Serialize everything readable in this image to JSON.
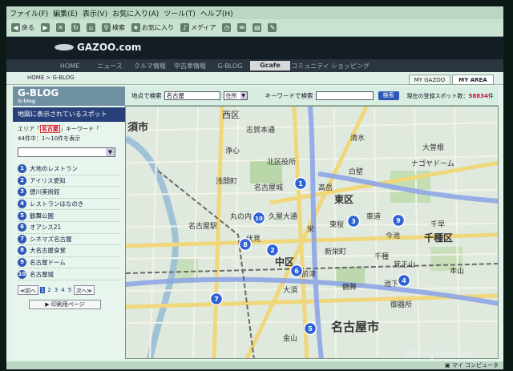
{
  "menubar": {
    "items": [
      "ファイル(F)",
      "編集(E)",
      "表示(V)",
      "お気に入り(A)",
      "ツール(T)",
      "ヘルプ(H)"
    ]
  },
  "toolbar": {
    "items": [
      {
        "label": "戻る",
        "icon": "back-icon"
      },
      {
        "label": "",
        "icon": "forward-icon"
      },
      {
        "label": "",
        "icon": "stop-icon"
      },
      {
        "label": "",
        "icon": "refresh-icon"
      },
      {
        "label": "",
        "icon": "home-icon"
      },
      {
        "label": "検索",
        "icon": "search-icon"
      },
      {
        "label": "お気に入り",
        "icon": "star-icon"
      },
      {
        "label": "メディア",
        "icon": "media-icon"
      },
      {
        "label": "",
        "icon": "history-icon"
      },
      {
        "label": "",
        "icon": "mail-icon"
      },
      {
        "label": "",
        "icon": "print-icon"
      },
      {
        "label": "",
        "icon": "edit-icon"
      }
    ]
  },
  "site": {
    "logo": "GAZOO.com",
    "nav": [
      "HOME",
      "ニュース",
      "クルマ情報",
      "中古車情報",
      "G-BLOG",
      "Gcafe",
      "コミュニティ",
      "ショッピング"
    ],
    "nav_active_index": 5,
    "breadcrumb": "HOME > G-BLOG",
    "tabs": {
      "my_gazoo": "MY GAZOO",
      "my_area": "MY AREA"
    }
  },
  "sidebar": {
    "title": "G-BLOG",
    "subtitle": "G-blog",
    "spots_header": "地図に表示されているスポット",
    "area_prefix": "エリア「",
    "area_value": "名古屋",
    "area_suffix": "」キーワード「",
    "keyword_value": "",
    "count_text": "44件中：1〜10件を表示",
    "select_value": "",
    "spots": [
      {
        "num": "1",
        "name": "大地のレストラン"
      },
      {
        "num": "2",
        "name": "アイリス愛知"
      },
      {
        "num": "3",
        "name": "徳川美術館"
      },
      {
        "num": "4",
        "name": "レストランはなのき"
      },
      {
        "num": "5",
        "name": "鶴舞公園"
      },
      {
        "num": "6",
        "name": "オアシス21"
      },
      {
        "num": "7",
        "name": "シネマズ名古屋"
      },
      {
        "num": "8",
        "name": "大名古屋食堂"
      },
      {
        "num": "9",
        "name": "名古屋ドーム"
      },
      {
        "num": "10",
        "name": "名古屋城"
      }
    ],
    "pager": {
      "prev": "≪前へ",
      "pages": [
        "1",
        "2",
        "3",
        "4",
        "5"
      ],
      "current": "1",
      "next": "次へ≫"
    },
    "print_label": "印刷用ページ"
  },
  "search": {
    "place_label": "地点で検索",
    "place_value": "名古屋",
    "type_value": "住所",
    "keyword_label": "キーワードで検索",
    "keyword_value": "",
    "button": "検索",
    "reg_prefix": "現在の登録スポット数：",
    "reg_count": "58834",
    "reg_suffix": "件"
  },
  "map": {
    "place_labels": [
      "西区",
      "東区",
      "中区",
      "千種区",
      "名古屋市",
      "須市",
      "北区役所",
      "栄",
      "今池",
      "大須",
      "金山",
      "名古屋城",
      "名古屋駅",
      "伏見",
      "上前津",
      "千種",
      "鶴舞",
      "御器所",
      "ナゴヤドーム",
      "志賀本通",
      "大曽根",
      "浄心",
      "浅間町",
      "丸の内",
      "久屋大通",
      "新栄町",
      "東桜",
      "池下",
      "覚王山",
      "本山",
      "千早",
      "清水",
      "白壁",
      "高岳",
      "車道"
    ],
    "markers": [
      "1",
      "2",
      "3",
      "4",
      "5",
      "6",
      "7",
      "8",
      "9",
      "10"
    ]
  },
  "statusbar": {
    "zone": "マイ コンピュータ"
  },
  "watermark": "Response."
}
